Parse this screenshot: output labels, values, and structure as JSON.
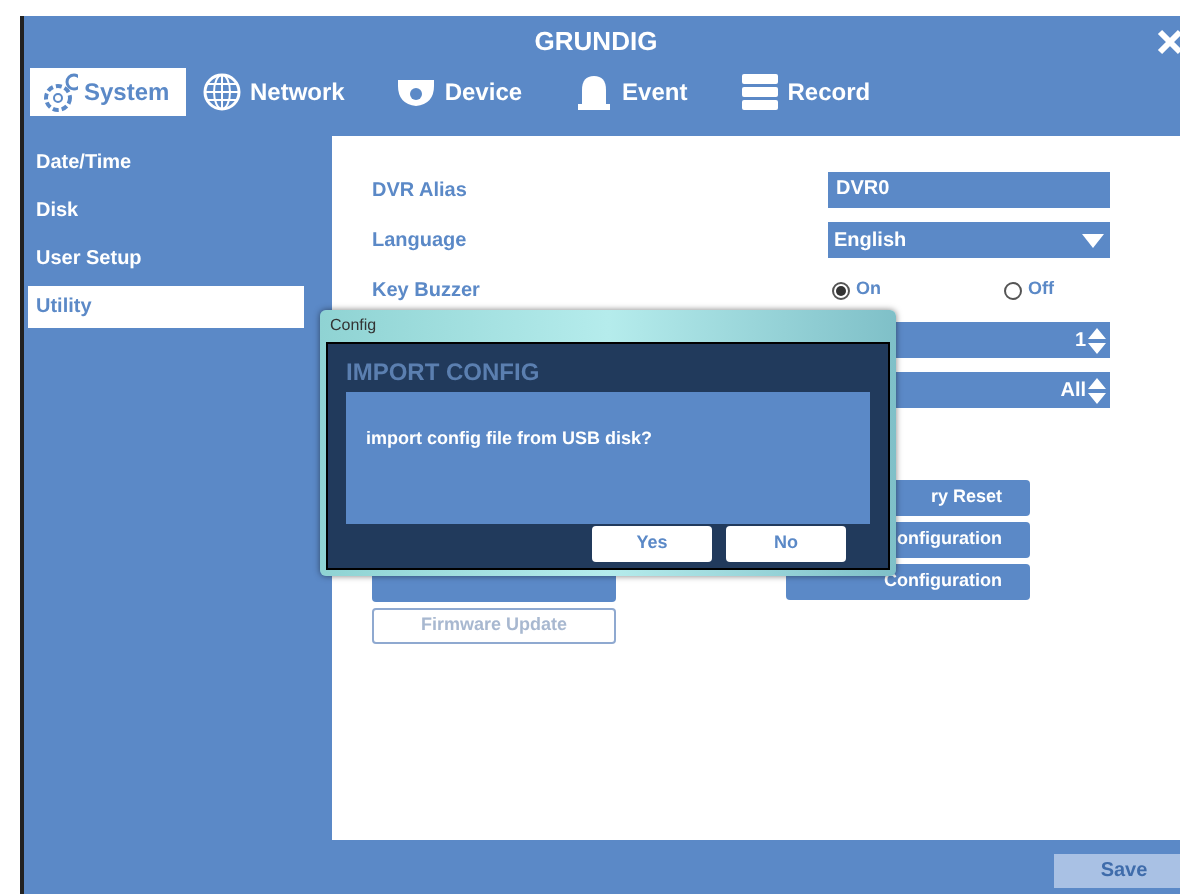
{
  "window": {
    "title": "GRUNDIG"
  },
  "tabs": [
    {
      "label": "System",
      "selected": true
    },
    {
      "label": "Network",
      "selected": false
    },
    {
      "label": "Device",
      "selected": false
    },
    {
      "label": "Event",
      "selected": false
    },
    {
      "label": "Record",
      "selected": false
    }
  ],
  "sidebar": {
    "items": [
      {
        "label": "Date/Time",
        "selected": false
      },
      {
        "label": "Disk",
        "selected": false
      },
      {
        "label": "User Setup",
        "selected": false
      },
      {
        "label": "Utility",
        "selected": true
      }
    ]
  },
  "settings": [
    {
      "kind": "text",
      "label": "DVR Alias",
      "value": "DVR0"
    },
    {
      "kind": "dropdown",
      "label": "Language",
      "value": "English"
    },
    {
      "kind": "radio",
      "label": "Key Buzzer",
      "options": [
        {
          "label": "On",
          "selected": true
        },
        {
          "label": "Off",
          "selected": false
        }
      ]
    },
    {
      "kind": "spinner",
      "value": "1"
    },
    {
      "kind": "spinner",
      "value": "All"
    }
  ],
  "left_buttons": [
    {
      "kind": "filled"
    },
    {
      "label": "Firmware Update",
      "kind": "outline"
    }
  ],
  "right_buttons": [
    {
      "label": "ry Reset"
    },
    {
      "label": "onfiguration"
    },
    {
      "label": "Configuration"
    }
  ],
  "save_button": {
    "label": "Save",
    "disabled": true
  },
  "dialog": {
    "window_title": "Config",
    "title": "IMPORT CONFIG",
    "message": "import config file from USB disk?",
    "buttons": [
      "Yes",
      "No"
    ]
  }
}
